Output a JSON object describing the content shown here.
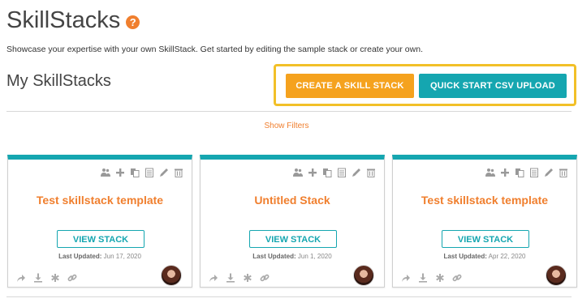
{
  "header": {
    "title": "SkillStacks",
    "help_icon": "question-circle-icon",
    "subtitle": "Showcase your expertise with your own SkillStack. Get started by editing the sample stack or create your own."
  },
  "section": {
    "title": "My SkillStacks",
    "create_button": "CREATE A SKILL STACK",
    "csv_button": "QUICK START CSV UPLOAD",
    "show_filters": "Show Filters"
  },
  "colors": {
    "accent_orange": "#f07f2e",
    "button_orange": "#f5a21e",
    "teal": "#15a6b0",
    "highlight": "#f2c028"
  },
  "cards": [
    {
      "title": "Test skillstack template",
      "view_label": "VIEW STACK",
      "updated_label": "Last Updated:",
      "updated_date": "Jun 17, 2020"
    },
    {
      "title": "Untitled Stack",
      "view_label": "VIEW STACK",
      "updated_label": "Last Updated:",
      "updated_date": "Jun 1, 2020"
    },
    {
      "title": "Test skillstack template",
      "view_label": "VIEW STACK",
      "updated_label": "Last Updated:",
      "updated_date": "Apr 22, 2020"
    }
  ],
  "card_tool_icons": [
    "users-icon",
    "plus-icon",
    "copy-icon",
    "document-icon",
    "pencil-icon",
    "trash-icon"
  ],
  "card_action_icons": [
    "share-icon",
    "download-icon",
    "asterisk-icon",
    "link-icon"
  ]
}
